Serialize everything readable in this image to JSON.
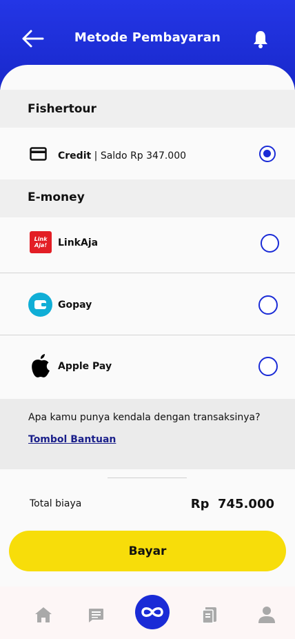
{
  "header": {
    "title": "Metode Pembayaran",
    "back_icon": "arrow-left-icon",
    "notification_icon": "bell-icon",
    "background_color": "#1a2bd6"
  },
  "sections": {
    "fishertour": {
      "title": "Fishertour",
      "credit": {
        "label": "Credit",
        "separator": " | ",
        "detail": "Saldo Rp 347.000",
        "icon": "credit-card-icon",
        "selected": true
      }
    },
    "emoney": {
      "title": "E-money",
      "options": [
        {
          "label": "LinkAja",
          "icon": "linkaja-logo",
          "logo_text": "Link Aja!",
          "selected": false
        },
        {
          "label": "Gopay",
          "icon": "gopay-wallet-icon",
          "selected": false
        },
        {
          "label": "Apple Pay",
          "icon": "apple-icon",
          "selected": false
        }
      ]
    }
  },
  "help": {
    "question": "Apa kamu punya kendala dengan transaksinya?",
    "link": "Tombol Bantuan"
  },
  "summary": {
    "total_label": "Total biaya",
    "total_value": "Rp  745.000"
  },
  "pay_button": {
    "label": "Bayar",
    "color": "#f7dd0a"
  },
  "bottom_nav": {
    "items": [
      "home-icon",
      "chat-icon",
      "infinity-icon",
      "receipt-icon",
      "profile-icon"
    ],
    "active_color": "#1a2bd6",
    "inactive_color": "#a9a9a9"
  },
  "accent_color": "#1a2bd6"
}
